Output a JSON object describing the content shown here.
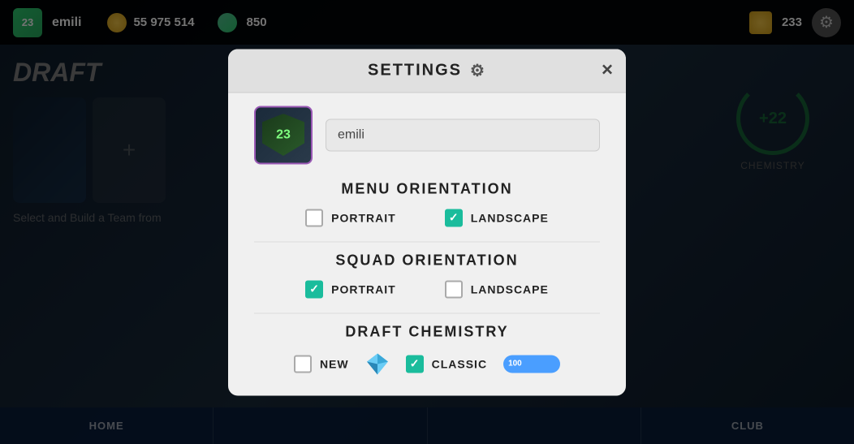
{
  "topbar": {
    "logo": "23",
    "username": "emili",
    "coins": "55 975 514",
    "nft_currency": "850",
    "trophy_count": "233"
  },
  "background": {
    "draft_title": "DRAFT",
    "select_text": "Select and Build a Team from",
    "chemistry_value": "+22",
    "chemistry_label": "CHEMISTRY"
  },
  "bottom_tabs": [
    {
      "label": "HOME"
    },
    {
      "label": ""
    },
    {
      "label": ""
    },
    {
      "label": "CLUB"
    }
  ],
  "modal": {
    "title": "SETTINGS",
    "close_label": "×",
    "gear_icon": "⚙",
    "profile": {
      "username_value": "emili",
      "username_placeholder": "emili"
    },
    "menu_orientation": {
      "section_title": "MENU ORIENTATION",
      "options": [
        {
          "label": "PORTRAIT",
          "checked": false
        },
        {
          "label": "LANDSCAPE",
          "checked": true
        }
      ]
    },
    "squad_orientation": {
      "section_title": "SQUAD ORIENTATION",
      "options": [
        {
          "label": "PORTRAIT",
          "checked": true
        },
        {
          "label": "LANDSCAPE",
          "checked": false
        }
      ]
    },
    "draft_chemistry": {
      "section_title": "DRAFT CHEMISTRY",
      "options": [
        {
          "label": "NEW",
          "checked": false
        },
        {
          "label": "CLASSIC",
          "checked": true
        }
      ],
      "slider_value": "100"
    }
  }
}
